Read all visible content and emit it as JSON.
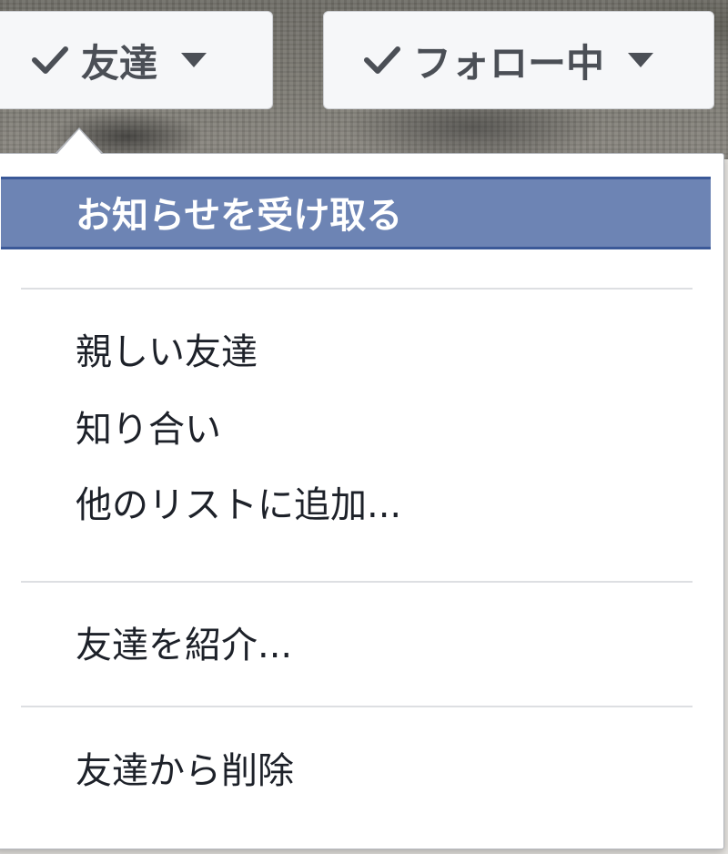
{
  "buttons": {
    "friends": {
      "label": "友達",
      "icon": "check-icon"
    },
    "following": {
      "label": "フォロー中",
      "icon": "check-icon"
    }
  },
  "menu": {
    "items": [
      {
        "label": "お知らせを受け取る",
        "highlighted": true
      },
      {
        "label": "親しい友達"
      },
      {
        "label": "知り合い"
      },
      {
        "label": "他のリストに追加..."
      },
      {
        "label": "友達を紹介..."
      },
      {
        "label": "友達から削除"
      }
    ]
  },
  "colors": {
    "highlight_bg": "#6d84b4",
    "highlight_border": "#3b5998",
    "button_bg": "#f6f7f9",
    "button_text": "#4b4f56",
    "menu_text": "#1d2129"
  }
}
